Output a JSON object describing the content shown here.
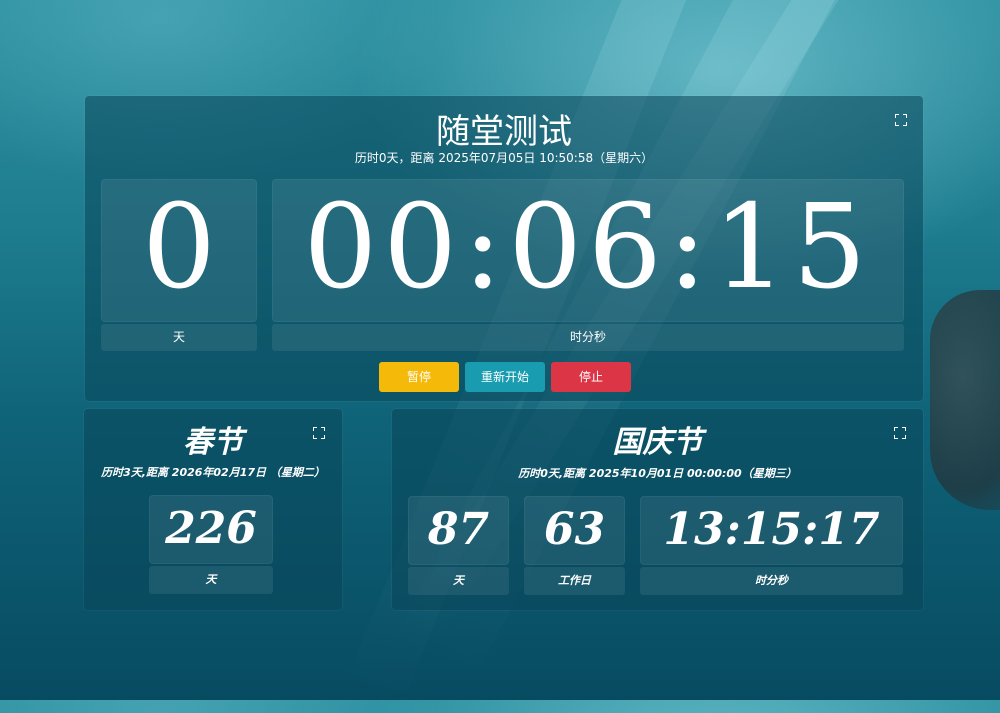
{
  "main": {
    "title": "随堂测试",
    "subtitle": "历时0天，距离 2025年07月05日 10:50:58（星期六）",
    "days_value": "0",
    "days_label": "天",
    "time_value": "00:06:15",
    "time_label": "时分秒",
    "buttons": {
      "pause": "暂停",
      "restart": "重新开始",
      "stop": "停止"
    },
    "colors": {
      "pause": "#f5b90a",
      "restart": "#1a9cb0",
      "stop": "#dc3545"
    }
  },
  "spring": {
    "title": "春节",
    "subtitle": "历时3天,距离  2026年02月17日 （星期二）",
    "days_value": "226",
    "days_label": "天"
  },
  "national": {
    "title": "国庆节",
    "subtitle": "历时0天,距离  2025年10月01日  00:00:00（星期三）",
    "days_value": "87",
    "days_label": "天",
    "workdays_value": "63",
    "workdays_label": "工作日",
    "time_value": "13:15:17",
    "time_label": "时分秒"
  },
  "icons": {
    "fullscreen": "fullscreen-icon"
  }
}
